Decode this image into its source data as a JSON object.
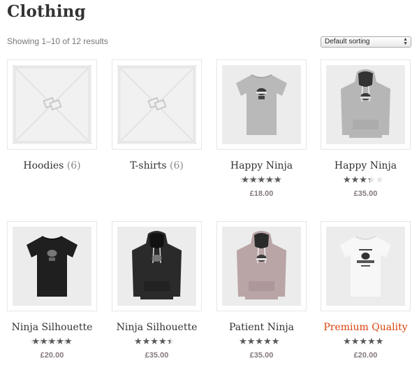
{
  "page": {
    "title": "Clothing",
    "result_count": "Showing 1–10 of 12 results",
    "ordering": {
      "selected": "Default sorting"
    }
  },
  "colors": {
    "accent": "#d9420b",
    "star": "#5a5a5a",
    "star_empty": "#e5e2e3",
    "price": "#85797f"
  },
  "items": [
    {
      "kind": "category",
      "name": "Hoodies",
      "count": "(6)",
      "image": "placeholder-icon"
    },
    {
      "kind": "category",
      "name": "T-shirts",
      "count": "(6)",
      "image": "placeholder-icon"
    },
    {
      "kind": "product",
      "name": "Happy Ninja",
      "rating": 5,
      "price": "£18.00",
      "image": "tshirt-grey-icon"
    },
    {
      "kind": "product",
      "name": "Happy Ninja",
      "rating": 3,
      "price": "£35.00",
      "image": "hoodie-grey-icon"
    },
    {
      "kind": "product",
      "name": "Ninja Silhouette",
      "rating": 5,
      "price": "£20.00",
      "image": "tshirt-black-icon"
    },
    {
      "kind": "product",
      "name": "Ninja Silhouette",
      "rating": 4,
      "price": "£35.00",
      "image": "hoodie-black-icon"
    },
    {
      "kind": "product",
      "name": "Patient Ninja",
      "rating": 4.5,
      "price": "£35.00",
      "image": "hoodie-mauve-icon"
    },
    {
      "kind": "product",
      "name": "Premium Quality",
      "rating": 4.5,
      "price": "£20.00",
      "image": "tshirt-white-icon",
      "highlight": true
    }
  ]
}
